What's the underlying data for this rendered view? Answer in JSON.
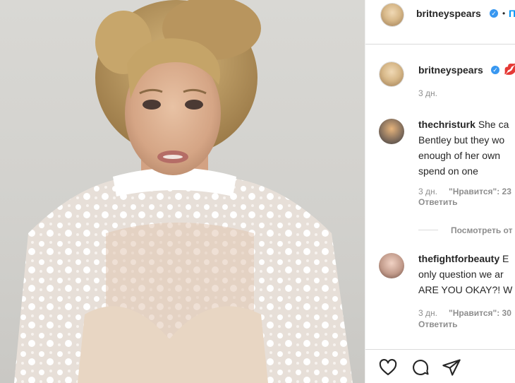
{
  "header": {
    "username": "britneyspears",
    "separator": "•",
    "follow_label": "П"
  },
  "caption": {
    "username": "britneyspears",
    "emoji": "💋",
    "time": "3 дн."
  },
  "comments": [
    {
      "username": "thechristurk",
      "lines": [
        "She ca",
        "Bentley but they wo",
        "enough of her own",
        "spend on one"
      ],
      "time": "3 дн.",
      "likes": "\"Нравится\": 23",
      "reply": "Ответить"
    },
    {
      "username": "thefightforbeauty",
      "lines": [
        "E",
        "only question we ar",
        "ARE YOU OKAY?! W"
      ],
      "time": "3 дн.",
      "likes": "\"Нравится\": 30",
      "reply": "Ответить"
    }
  ],
  "view_replies": "Посмотреть от",
  "actions": {
    "like_icon": "heart-icon",
    "comment_icon": "comment-icon",
    "share_icon": "paper-plane-icon"
  },
  "colors": {
    "verified": "#3897f0",
    "muted": "#8e8e8e",
    "text": "#262626"
  }
}
